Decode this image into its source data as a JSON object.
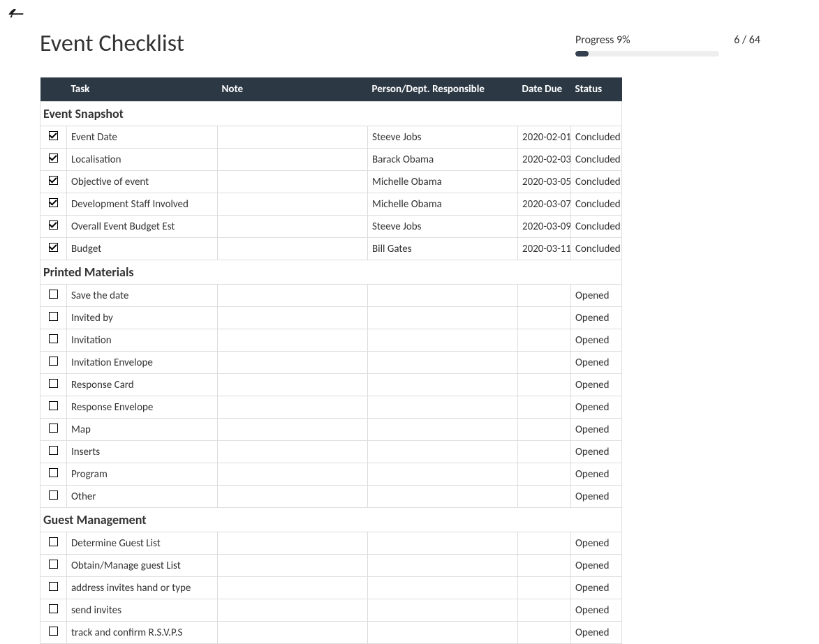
{
  "header": {
    "title": "Event Checklist",
    "progress_label": "Progress 9%",
    "count_label": "6 / 64",
    "progress_pct": 9
  },
  "columns": {
    "task": "Task",
    "note": "Note",
    "person": "Person/Dept. Responsible",
    "date": "Date Due",
    "status": "Status"
  },
  "sections": [
    {
      "title": "Event Snapshot",
      "rows": [
        {
          "checked": true,
          "task": "Event Date",
          "note": "",
          "person": "Steeve Jobs",
          "date": "2020-02-01",
          "status": "Concluded"
        },
        {
          "checked": true,
          "task": "Localisation",
          "note": "",
          "person": "Barack Obama",
          "date": "2020-02-03",
          "status": "Concluded"
        },
        {
          "checked": true,
          "task": "Objective of event",
          "note": "",
          "person": "Michelle Obama",
          "date": "2020-03-05",
          "status": "Concluded"
        },
        {
          "checked": true,
          "task": "Development Staff Involved",
          "note": "",
          "person": "Michelle Obama",
          "date": "2020-03-07",
          "status": "Concluded"
        },
        {
          "checked": true,
          "task": "Overall Event Budget Est",
          "note": "",
          "person": "Steeve Jobs",
          "date": "2020-03-09",
          "status": "Concluded"
        },
        {
          "checked": true,
          "task": "Budget",
          "note": "",
          "person": "Bill Gates",
          "date": "2020-03-11",
          "status": "Concluded"
        }
      ]
    },
    {
      "title": "Printed Materials",
      "rows": [
        {
          "checked": false,
          "task": "Save the date",
          "note": "",
          "person": "",
          "date": "",
          "status": "Opened"
        },
        {
          "checked": false,
          "task": "Invited by",
          "note": "",
          "person": "",
          "date": "",
          "status": "Opened"
        },
        {
          "checked": false,
          "task": "Invitation",
          "note": "",
          "person": "",
          "date": "",
          "status": "Opened"
        },
        {
          "checked": false,
          "task": "Invitation Envelope",
          "note": "",
          "person": "",
          "date": "",
          "status": "Opened"
        },
        {
          "checked": false,
          "task": "Response Card",
          "note": "",
          "person": "",
          "date": "",
          "status": "Opened"
        },
        {
          "checked": false,
          "task": "Response Envelope",
          "note": "",
          "person": "",
          "date": "",
          "status": "Opened"
        },
        {
          "checked": false,
          "task": "Map",
          "note": "",
          "person": "",
          "date": "",
          "status": "Opened"
        },
        {
          "checked": false,
          "task": "Inserts",
          "note": "",
          "person": "",
          "date": "",
          "status": "Opened"
        },
        {
          "checked": false,
          "task": "Program",
          "note": "",
          "person": "",
          "date": "",
          "status": "Opened"
        },
        {
          "checked": false,
          "task": "Other",
          "note": "",
          "person": "",
          "date": "",
          "status": "Opened"
        }
      ]
    },
    {
      "title": "Guest Management",
      "rows": [
        {
          "checked": false,
          "task": "Determine Guest List",
          "note": "",
          "person": "",
          "date": "",
          "status": "Opened"
        },
        {
          "checked": false,
          "task": "Obtain/Manage guest List",
          "note": "",
          "person": "",
          "date": "",
          "status": "Opened"
        },
        {
          "checked": false,
          "task": "address invites hand or type",
          "note": "",
          "person": "",
          "date": "",
          "status": "Opened"
        },
        {
          "checked": false,
          "task": "send invites",
          "note": "",
          "person": "",
          "date": "",
          "status": "Opened"
        },
        {
          "checked": false,
          "task": "track and confirm R.S.V.P.S",
          "note": "",
          "person": "",
          "date": "",
          "status": "Opened"
        }
      ]
    }
  ]
}
